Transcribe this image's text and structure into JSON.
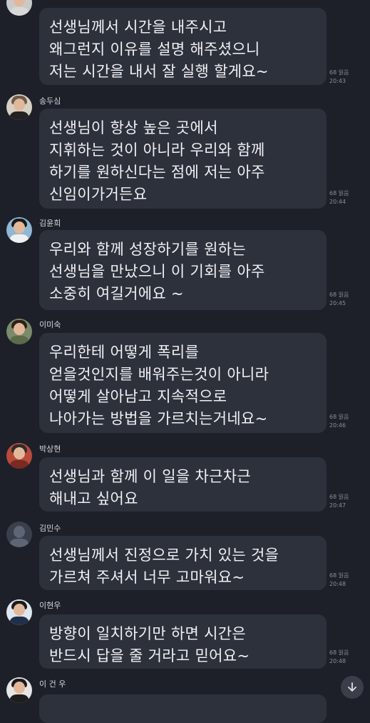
{
  "messages": [
    {
      "sender": "",
      "text": "선생님께서 시간을 내주시고\n왜그런지 이유를 설명 해주셨으니\n저는 시간을 내서 잘 실행  할게요~",
      "read": "68 읽음",
      "time": "20:43"
    },
    {
      "sender": "송두심",
      "text": "선생님이 항상 높은 곳에서\n지휘하는 것이 아니라 우리와 함께\n하기를 원하신다는 점에 저는 아주\n신임이가거든요",
      "read": "68 읽음",
      "time": "20:44"
    },
    {
      "sender": "김윤희",
      "text": "우리와 함께 성장하기를 원하는\n선생님을 만났으니  이 기회를 아주\n소중히 여길거에요 ~",
      "read": "68 읽음",
      "time": "20:45"
    },
    {
      "sender": "이미숙",
      "text": "우리한테 어떻게 폭리를\n얻을것인지를 배워주는것이 아니라\n어떻게 살아남고 지속적으로\n나아가는 방법을 가르치는거네요~",
      "read": "68 읽음",
      "time": "20:46"
    },
    {
      "sender": "박상현",
      "text": "선생님과 함께 이 일을 차근차근\n해내고 싶어요",
      "read": "68 읽음",
      "time": "20:47"
    },
    {
      "sender": "김민수",
      "text": "선생님께서 진정으로 가치 있는 것을\n가르쳐 주셔서 너무 고마워요~",
      "read": "68 읽음",
      "time": "20:48"
    },
    {
      "sender": "이현우",
      "text": "방향이 일치하기만 하면 시간은\n반드시 답을 줄 거라고 믿어요~",
      "read": "68 읽음",
      "time": "20:48"
    },
    {
      "sender": "이 건 우",
      "text": "",
      "read": "",
      "time": ""
    }
  ],
  "scroll_button": {
    "icon": "arrow-down-icon"
  },
  "colors": {
    "background": "#1d2029",
    "bubble": "#2d313c"
  }
}
